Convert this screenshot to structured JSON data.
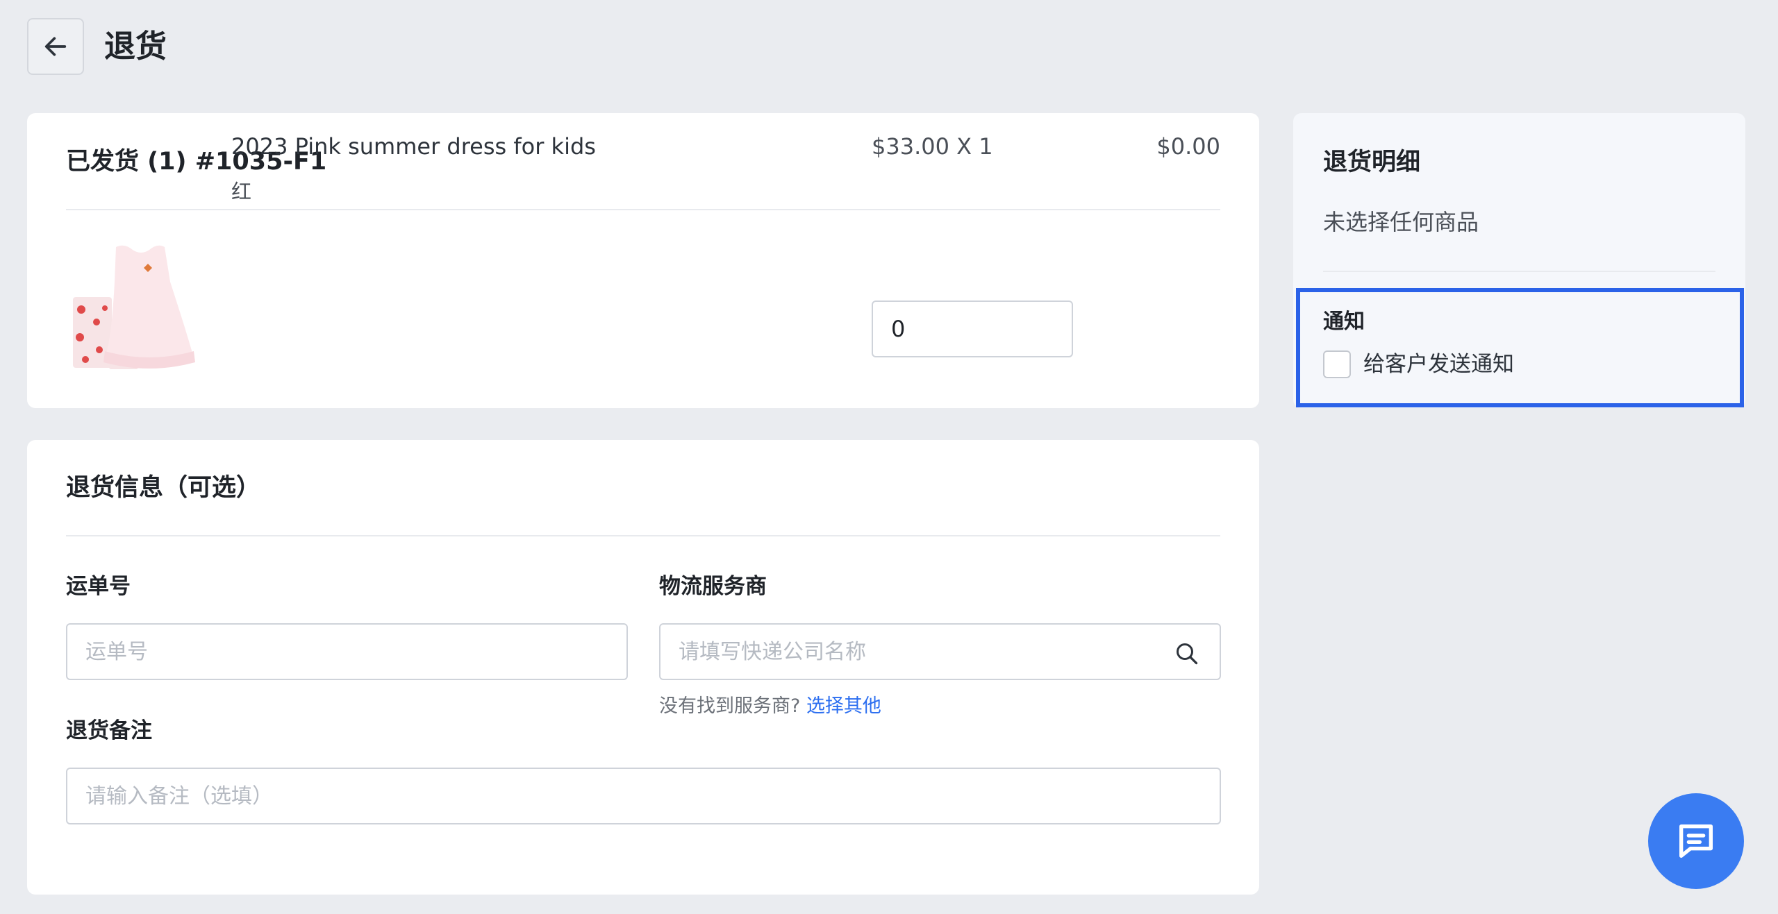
{
  "header": {
    "title": "退货",
    "back_icon": "arrow-left-icon"
  },
  "shipment": {
    "title": "已发货 (1) #1035-F1",
    "item": {
      "name": "2023 Pink summer dress for kids",
      "variant": "红",
      "unit_price": "$33.00 X 1",
      "line_total": "$0.00",
      "quantity_value": "0"
    }
  },
  "return_info": {
    "title": "退货信息（可选）",
    "tracking_label": "运单号",
    "tracking_placeholder": "运单号",
    "carrier_label": "物流服务商",
    "carrier_placeholder": "请填写快递公司名称",
    "carrier_hint": "没有找到服务商?",
    "carrier_hint_link": "选择其他",
    "note_label": "退货备注",
    "note_placeholder": "请输入备注（选填）"
  },
  "summary": {
    "title": "退货明细",
    "empty_text": "未选择任何商品",
    "notify_title": "通知",
    "notify_checkbox_label": "给客户发送通知",
    "notify_checked": false
  },
  "colors": {
    "accent": "#2b62e8",
    "link": "#2b6ef0",
    "fab": "#3a7cf2",
    "background": "#eaecf0"
  }
}
